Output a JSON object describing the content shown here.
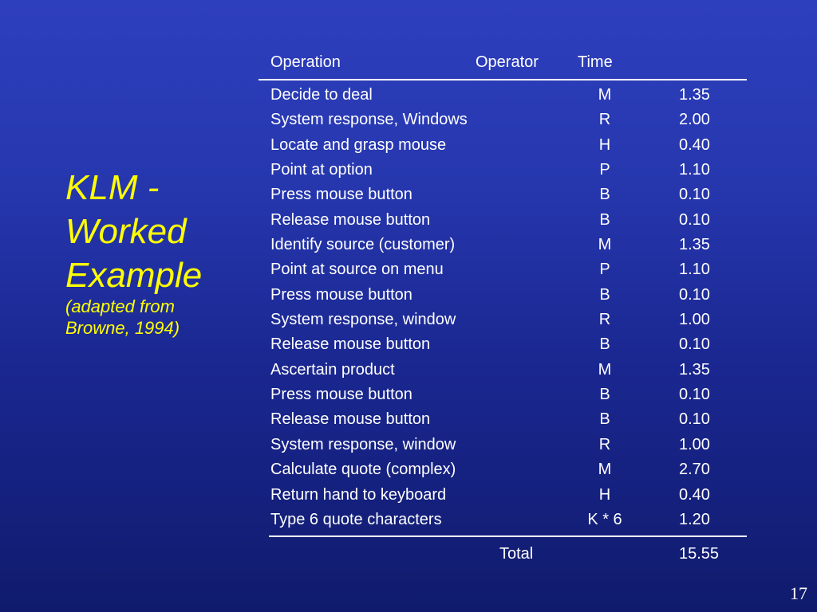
{
  "title": {
    "line1": "KLM -",
    "line2": "Worked",
    "line3": "Example",
    "subtitle1": "(adapted from",
    "subtitle2": "Browne, 1994)"
  },
  "table": {
    "headers": {
      "operation": "Operation",
      "operator": "Operator",
      "time": "Time"
    },
    "rows": [
      {
        "operation": "Decide to deal",
        "operator": "M",
        "time": "1.35"
      },
      {
        "operation": "System response, Windows",
        "operator": "R",
        "time": "2.00"
      },
      {
        "operation": "Locate and grasp mouse",
        "operator": "H",
        "time": "0.40"
      },
      {
        "operation": "Point at option",
        "operator": "P",
        "time": "1.10"
      },
      {
        "operation": "Press mouse button",
        "operator": "B",
        "time": "0.10"
      },
      {
        "operation": "Release mouse button",
        "operator": "B",
        "time": "0.10"
      },
      {
        "operation": "Identify source (customer)",
        "operator": "M",
        "time": "1.35"
      },
      {
        "operation": "Point at source on menu",
        "operator": "P",
        "time": "1.10"
      },
      {
        "operation": "Press mouse button",
        "operator": "B",
        "time": "0.10"
      },
      {
        "operation": "System response, window",
        "operator": "R",
        "time": "1.00"
      },
      {
        "operation": "Release mouse button",
        "operator": "B",
        "time": "0.10"
      },
      {
        "operation": "Ascertain product",
        "operator": "M",
        "time": "1.35"
      },
      {
        "operation": "Press mouse button",
        "operator": "B",
        "time": "0.10"
      },
      {
        "operation": "Release mouse button",
        "operator": "B",
        "time": "0.10"
      },
      {
        "operation": "System response, window",
        "operator": "R",
        "time": "1.00"
      },
      {
        "operation": "Calculate quote (complex)",
        "operator": "M",
        "time": "2.70"
      },
      {
        "operation": "Return hand to keyboard",
        "operator": "H",
        "time": "0.40"
      },
      {
        "operation": "Type 6 quote characters",
        "operator": "K * 6",
        "time": "1.20"
      }
    ],
    "total_label": "Total",
    "total_value": "15.55"
  },
  "page_number": "17",
  "colors": {
    "title": "#ffff00",
    "text": "#ffffff",
    "background_top": "#2e3fbe",
    "background_bottom": "#101b6d"
  }
}
